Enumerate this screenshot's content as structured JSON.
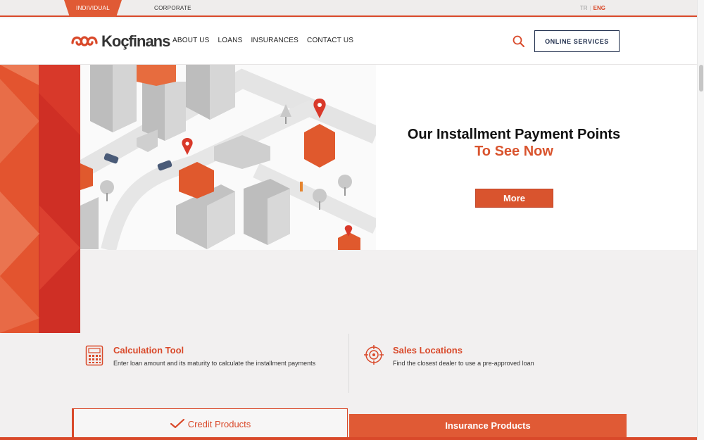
{
  "top_bar": {
    "segment_individual": "INDIVIDUAL",
    "segment_corporate": "CORPORATE",
    "lang_tr": "TR",
    "lang_en": "ENG"
  },
  "header": {
    "logo_text": "Koçfinans",
    "nav": [
      "ABOUT US",
      "LOANS",
      "INSURANCES",
      "CONTACT US"
    ],
    "search_icon": "search-icon",
    "online_services": "ONLINE SERVICES"
  },
  "hero": {
    "title": "Our Installment Payment Points",
    "subtitle": "To See Now",
    "button": "More"
  },
  "tools": [
    {
      "icon": "calculator-icon",
      "title": "Calculation Tool",
      "description": "Enter loan amount and its maturity to calculate the installment payments"
    },
    {
      "icon": "target-icon",
      "title": "Sales Locations",
      "description": "Find the closest dealer to use a pre-approved loan"
    }
  ],
  "product_tabs": {
    "credit": "Credit Products",
    "insurance": "Insurance Products"
  },
  "colors": {
    "brand_orange": "#d9492a",
    "navy": "#1c2b4a",
    "background": "#f2f0f0"
  }
}
